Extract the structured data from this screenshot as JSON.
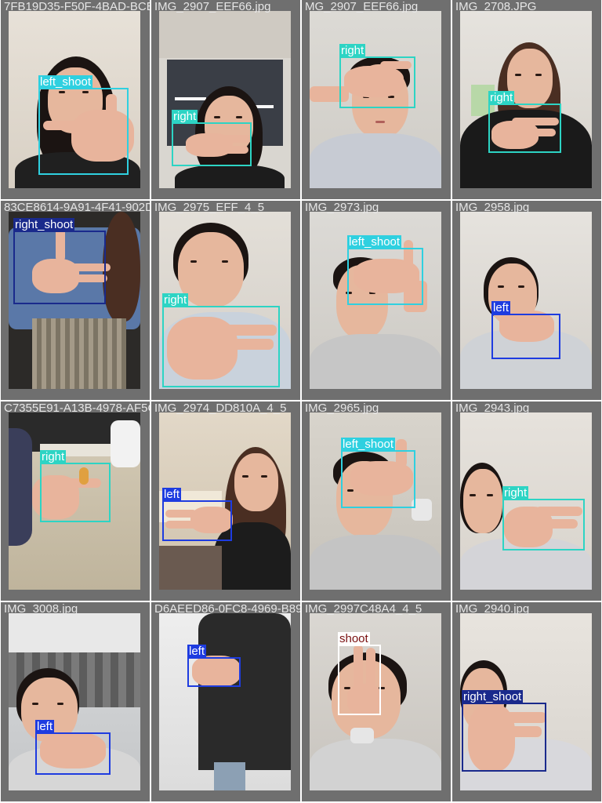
{
  "tiles": [
    {
      "filename": "7FB19D35-F50F-4BAD-BCE8-98FFD4C5D788_jpg.rf.8MG_2907_EEF66.jpg",
      "boxes": [
        {
          "label": "left_shoot",
          "cls": "left_shoot"
        }
      ]
    },
    {
      "filename": "IMG_2907_EEF66.jpg",
      "boxes": [
        {
          "label": "right",
          "cls": "right"
        }
      ]
    },
    {
      "filename": "MG_2907_EEF66.jpg",
      "boxes": [
        {
          "label": "right",
          "cls": "right"
        }
      ]
    },
    {
      "filename": "IMG_2708.JPG",
      "boxes": [
        {
          "label": "right",
          "cls": "right"
        }
      ]
    },
    {
      "filename": "83CE8614-9A91-4F41-902D-4722EFF_4_5",
      "boxes": [
        {
          "label": "right_shoot",
          "cls": "right_shoot"
        }
      ]
    },
    {
      "filename": "IMG_2975_EFF_4_5",
      "boxes": [
        {
          "label": "right",
          "cls": "right"
        }
      ]
    },
    {
      "filename": "IMG_2973.jpg",
      "boxes": [
        {
          "label": "left_shoot",
          "cls": "left_shoot"
        }
      ]
    },
    {
      "filename": "IMG_2958.jpg",
      "boxes": [
        {
          "label": "left",
          "cls": "left"
        }
      ]
    },
    {
      "filename": "C7355E91-A13B-4978-AF5C-922785DD810A_4_5",
      "boxes": [
        {
          "label": "right",
          "cls": "right"
        }
      ]
    },
    {
      "filename": "IMG_2974_DD810A_4_5",
      "boxes": [
        {
          "label": "left",
          "cls": "left"
        }
      ]
    },
    {
      "filename": "IMG_2965.jpg",
      "boxes": [
        {
          "label": "left_shoot",
          "cls": "left_shoot"
        }
      ]
    },
    {
      "filename": "IMG_2943.jpg",
      "boxes": [
        {
          "label": "right",
          "cls": "right"
        }
      ]
    },
    {
      "filename": "IMG_3008.jpg",
      "boxes": [
        {
          "label": "left",
          "cls": "left"
        }
      ]
    },
    {
      "filename": "D6AEED86-0FC8-4969-B89C-B99763C48A4_4_5",
      "boxes": [
        {
          "label": "left",
          "cls": "left"
        }
      ]
    },
    {
      "filename": "IMG_2997C48A4_4_5",
      "boxes": [
        {
          "label": "shoot",
          "cls": "shoot"
        }
      ]
    },
    {
      "filename": "IMG_2940.jpg",
      "boxes": [
        {
          "label": "right_shoot",
          "cls": "right_shoot"
        }
      ]
    }
  ],
  "colors": {
    "right": "#2dd4c4",
    "left_shoot": "#2fd0e0",
    "left": "#1e3ce0",
    "right_shoot": "#1a2a8c",
    "shoot": "#ffffff",
    "tile_border": "#6f6f6f"
  }
}
